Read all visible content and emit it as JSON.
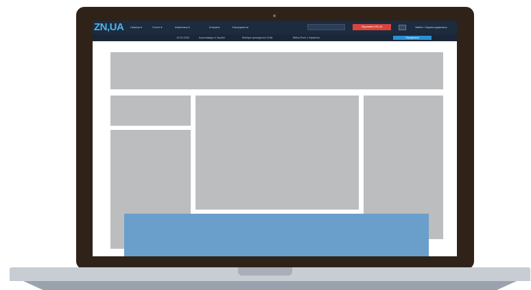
{
  "site": {
    "logo": "ZN,UA",
    "nav": [
      "Новини ▾",
      "Статті ▾",
      "Аналітика ▾",
      "Інтерв'ю",
      "Спецпроекти"
    ],
    "alert_button": "Підтримати ZN.UA",
    "login": "Увійти / Зареєструватися",
    "subnav": [
      "19.02.2020",
      "Коронавірус в Україні",
      "Вибори президента США",
      "Війна Росії з Україною"
    ],
    "subscribe_button": "Передплата"
  },
  "colors": {
    "laptop_frame": "#2f2219",
    "header_bg": "#1d2b3f",
    "logo": "#4fb3e8",
    "alert": "#d9453b",
    "subscribe": "#2b8fd6",
    "placeholder": "#bcbdbf",
    "overlay": "#6a9ecb"
  }
}
